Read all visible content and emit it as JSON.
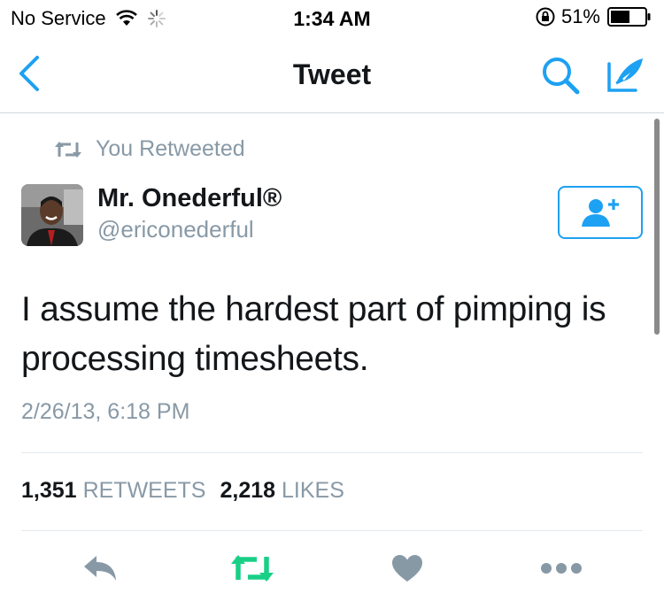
{
  "status_bar": {
    "carrier": "No Service",
    "time": "1:34 AM",
    "battery": "51%"
  },
  "nav": {
    "title": "Tweet",
    "icons": [
      "chevron-left-icon",
      "search-icon",
      "compose-icon"
    ]
  },
  "tweet": {
    "context": "You Retweeted",
    "author_name": "Mr. Onederful®",
    "author_handle": "@ericonederful",
    "text": "I assume the hardest part of pimping is processing timesheets.",
    "timestamp": "2/26/13, 6:18 PM",
    "retweets_count": "1,351",
    "retweets_label": "RETWEETS",
    "likes_count": "2,218",
    "likes_label": "LIKES"
  },
  "actions": [
    "reply-icon",
    "retweet-icon",
    "like-icon",
    "more-icon"
  ],
  "colors": {
    "accent": "#1da1f2",
    "retweet_active": "#19cf86",
    "secondary_text": "#8899a6",
    "action_gray": "#8899a6",
    "divider": "#e1e8ed"
  }
}
